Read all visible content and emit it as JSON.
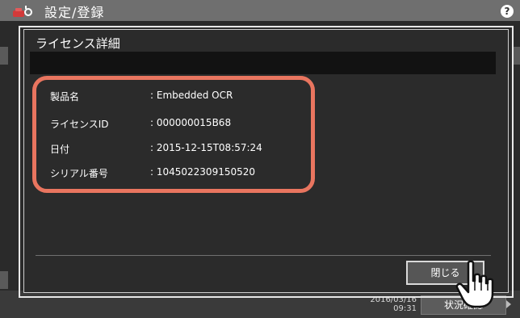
{
  "header": {
    "title": "設定/登録",
    "help_label": "?"
  },
  "dialog": {
    "title": "ライセンス詳細",
    "fields": [
      {
        "label": "製品名",
        "value": ": Embedded OCR"
      },
      {
        "label": "ライセンスID",
        "value": ": 000000015B68"
      },
      {
        "label": "日付",
        "value": ": 2015-12-15T08:57:24"
      },
      {
        "label": "シリアル番号",
        "value": ": 1045022309150520"
      }
    ],
    "close_label": "閉じる"
  },
  "footer": {
    "date": "2016/03/16",
    "time": "09:31",
    "status_label": "状況確認"
  },
  "colors": {
    "highlight": "#e9755f",
    "background": "#2a2a2a",
    "topbar": "#6f6f6f"
  }
}
